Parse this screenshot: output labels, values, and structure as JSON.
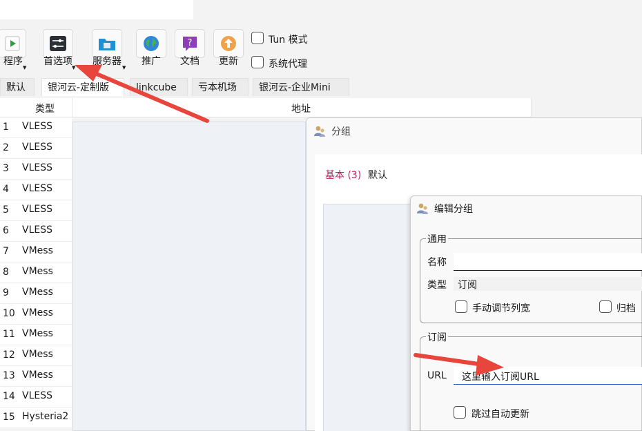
{
  "toolbar": {
    "programs_label": "程序",
    "preferences_label": "首选项",
    "servers_label": "服务器",
    "promote_label": "推广",
    "docs_label": "文档",
    "update_label": "更新"
  },
  "options": {
    "tun_label": "Tun 模式",
    "system_proxy_label": "系统代理"
  },
  "tabs": [
    "默认",
    "银河云-定制版",
    "linkcube",
    "亏本机场",
    "银河云-企业Mini"
  ],
  "table": {
    "col_type": "类型",
    "col_address": "地址",
    "rows": [
      {
        "num": "1",
        "type": "VLESS"
      },
      {
        "num": "2",
        "type": "VLESS"
      },
      {
        "num": "3",
        "type": "VLESS"
      },
      {
        "num": "4",
        "type": "VLESS"
      },
      {
        "num": "5",
        "type": "VLESS"
      },
      {
        "num": "6",
        "type": "VLESS"
      },
      {
        "num": "7",
        "type": "VMess"
      },
      {
        "num": "8",
        "type": "VMess"
      },
      {
        "num": "9",
        "type": "VMess"
      },
      {
        "num": "10",
        "type": "VMess"
      },
      {
        "num": "11",
        "type": "VMess"
      },
      {
        "num": "12",
        "type": "VMess"
      },
      {
        "num": "13",
        "type": "VMess"
      },
      {
        "num": "14",
        "type": "VLESS"
      },
      {
        "num": "15",
        "type": "Hysteria2"
      }
    ]
  },
  "group_window": {
    "title": "分组",
    "tab_basic": "基本 (3)",
    "tab_default": "默认"
  },
  "edit_window": {
    "title": "编辑分组",
    "general_legend": "通用",
    "name_label": "名称",
    "name_value": "",
    "type_label": "类型",
    "type_value": "订阅",
    "manual_col_label": "手动调节列宽",
    "archive_label": "归档",
    "subscription_legend": "订阅",
    "url_label": "URL",
    "url_value": "这里输入订阅URL",
    "skip_update_label": "跳过自动更新"
  },
  "colors": {
    "arrow": "#e8453c",
    "accent_pink": "#c2185b"
  }
}
